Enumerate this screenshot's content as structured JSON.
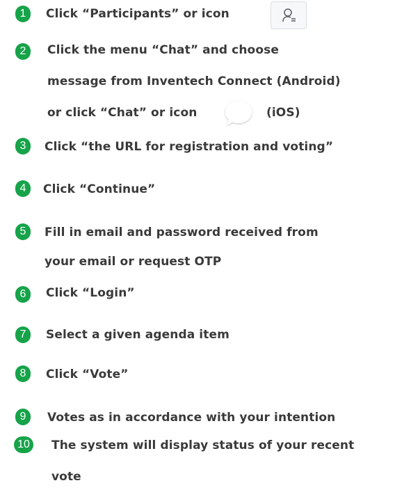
{
  "accent_color": "#16a34a",
  "steps": [
    {
      "number": "1",
      "lines": [
        "Click “Participants” or icon"
      ]
    },
    {
      "number": "2",
      "lines": [
        "Click the menu “Chat” and choose",
        "message from Inventech Connect (Android)",
        "or click “Chat” or icon",
        "(iOS)"
      ]
    },
    {
      "number": "3",
      "lines": [
        "Click “the URL for registration and voting”"
      ]
    },
    {
      "number": "4",
      "lines": [
        "Click “Continue”"
      ]
    },
    {
      "number": "5",
      "lines": [
        "Fill in email and password received from",
        "your email or request OTP"
      ]
    },
    {
      "number": "6",
      "lines": [
        "Click “Login”"
      ]
    },
    {
      "number": "7",
      "lines": [
        "Select a given agenda item"
      ]
    },
    {
      "number": "8",
      "lines": [
        "Click “Vote”"
      ]
    },
    {
      "number": "9",
      "lines": [
        "Votes as in accordance with your intention"
      ]
    },
    {
      "number": "10",
      "lines": [
        "The system will display status of your recent",
        "vote"
      ]
    }
  ],
  "icons": {
    "participants": "participants-icon",
    "chat": "chat-bubble-icon"
  }
}
